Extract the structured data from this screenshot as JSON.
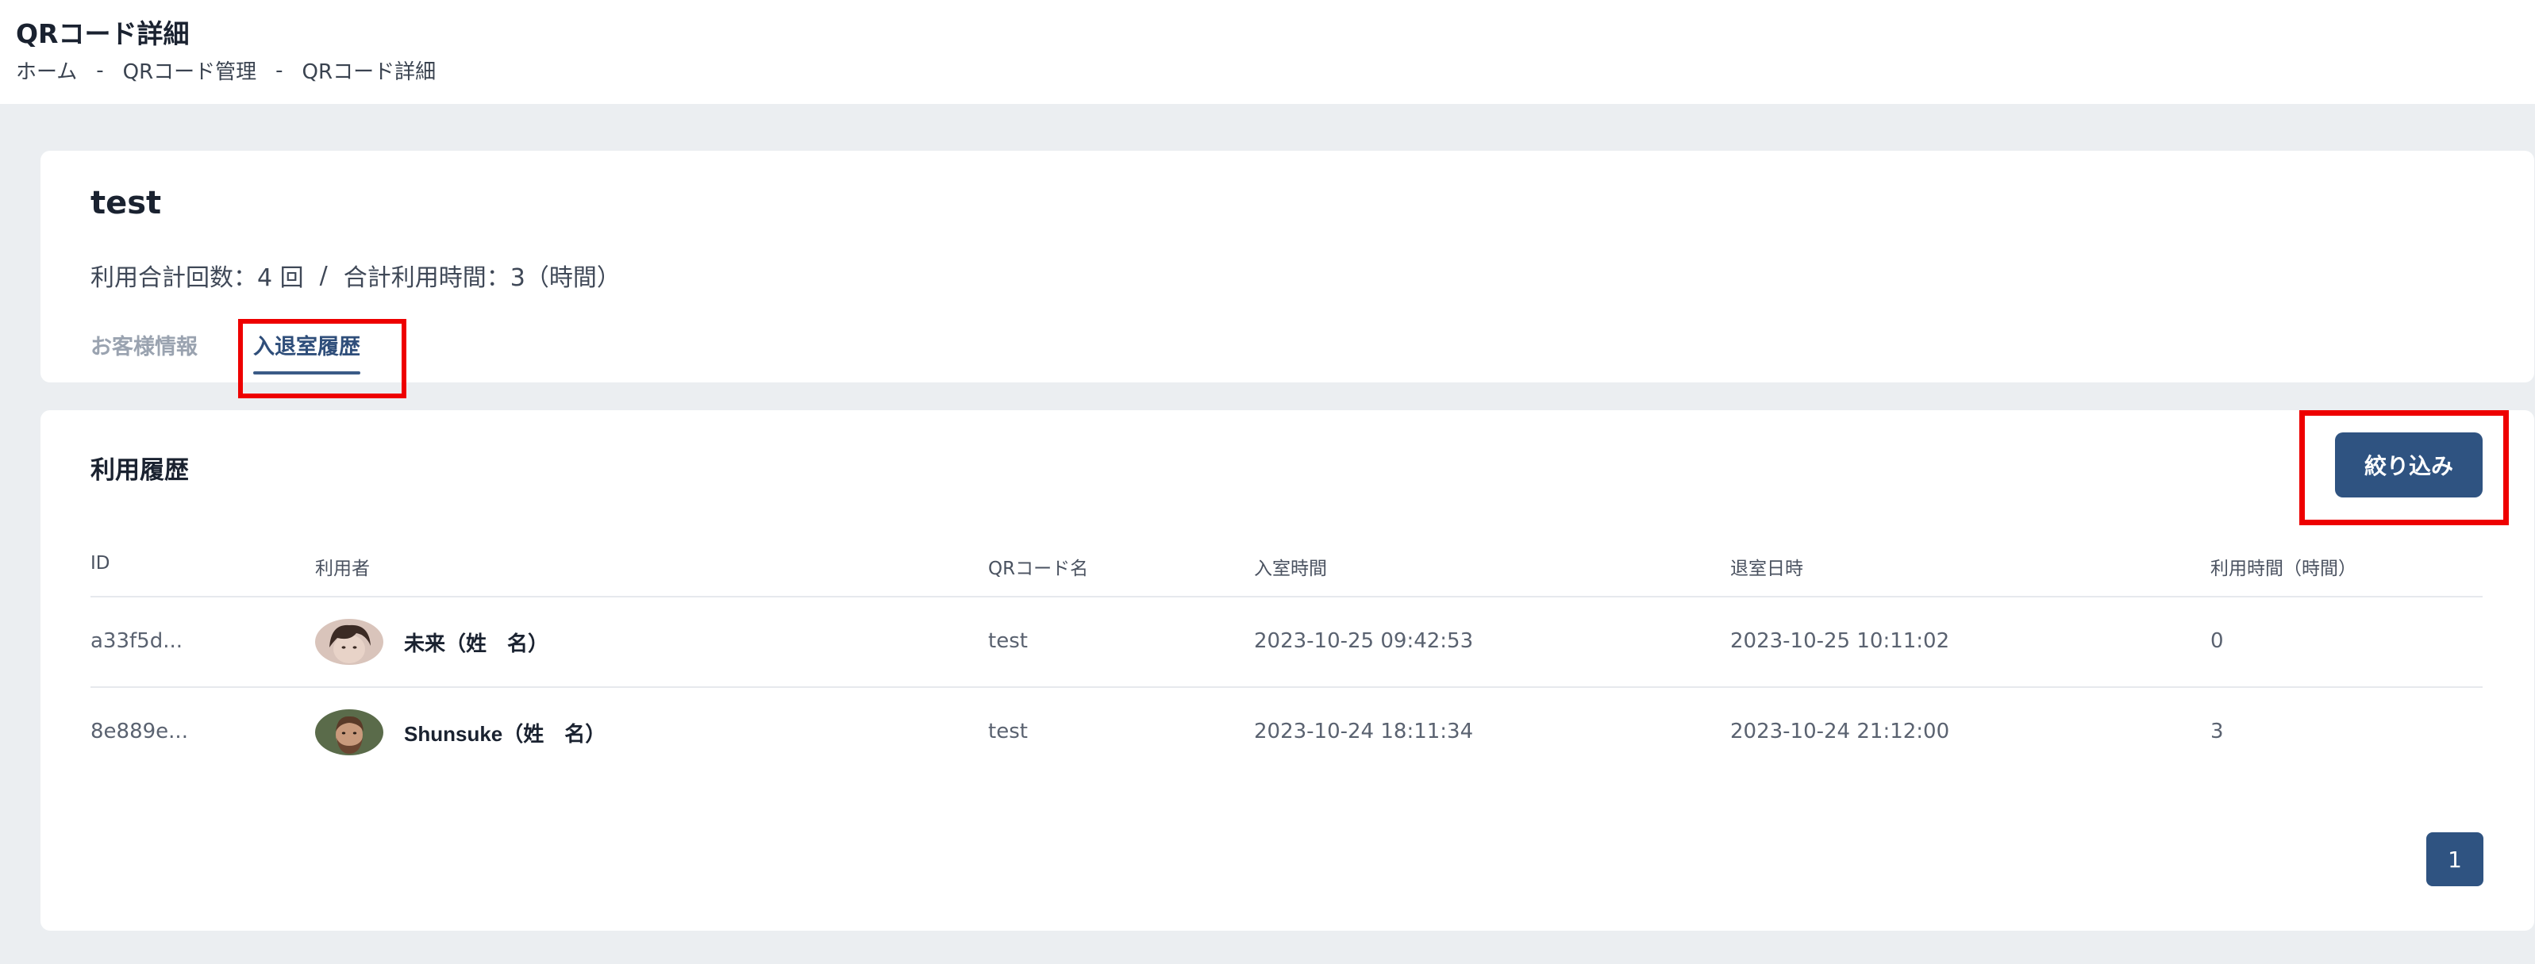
{
  "header": {
    "title": "QRコード詳細",
    "breadcrumb": [
      "ホーム",
      "QRコード管理",
      "QRコード詳細"
    ],
    "separator": "-"
  },
  "summary": {
    "name": "test",
    "usage_count": "利用合計回数：4 回",
    "slash": "/",
    "usage_time": "合計利用時間：3（時間）"
  },
  "tabs": [
    {
      "label": "お客様情報",
      "active": false
    },
    {
      "label": "入退室履歴",
      "active": true
    }
  ],
  "history": {
    "title": "利用履歴",
    "filter_label": "絞り込み",
    "columns": [
      "ID",
      "利用者",
      "QRコード名",
      "入室時間",
      "退室日時",
      "利用時間（時間）"
    ],
    "rows": [
      {
        "id": "a33f5d...",
        "user": "未来（姓　名）",
        "qr_name": "test",
        "entry": "2023-10-25 09:42:53",
        "exit": "2023-10-25 10:11:02",
        "duration": "0"
      },
      {
        "id": "8e889e...",
        "user": "Shunsuke（姓　名）",
        "qr_name": "test",
        "entry": "2023-10-24 18:11:34",
        "exit": "2023-10-24 21:12:00",
        "duration": "3"
      }
    ]
  },
  "pagination": {
    "current": "1"
  },
  "colors": {
    "accent": "#2f5381",
    "highlight": "#ee0000",
    "background": "#ebeef1"
  }
}
